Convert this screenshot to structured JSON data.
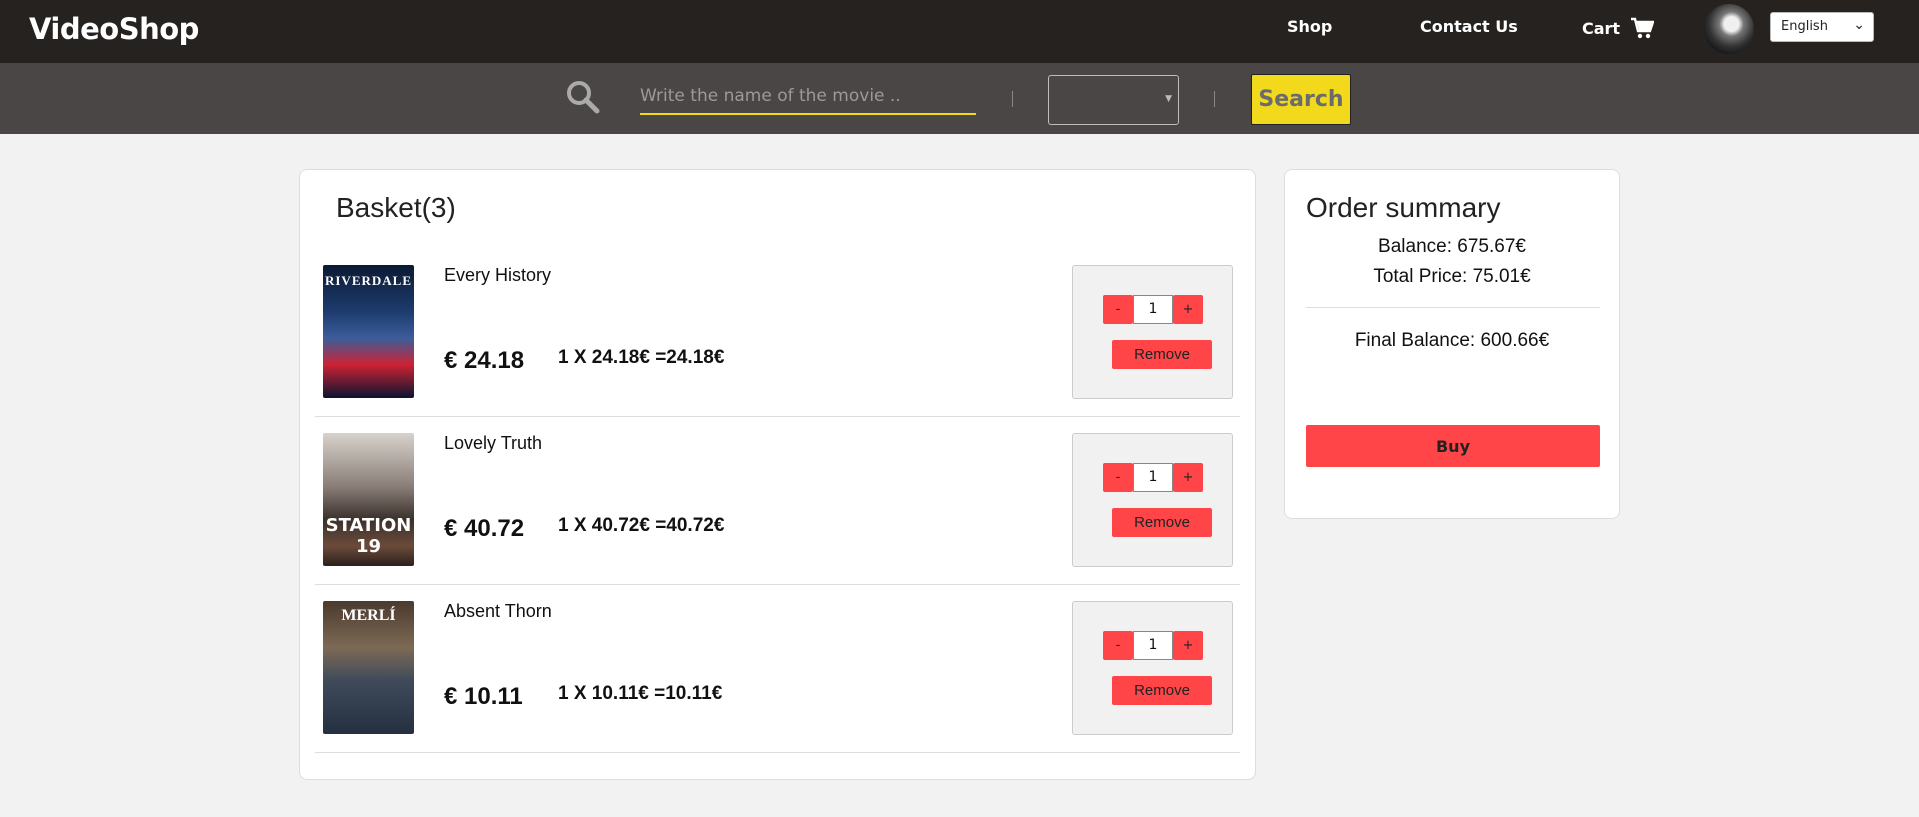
{
  "nav": {
    "brand": "VideoShop",
    "shop": "Shop",
    "contact": "Contact Us",
    "cart": "Cart",
    "language": "English"
  },
  "search": {
    "placeholder": "Write the name of the movie ..",
    "button": "Search",
    "genre_value": ""
  },
  "basket": {
    "title": "Basket(3)",
    "items": [
      {
        "name": "Every History",
        "price": "€ 24.18",
        "calc": "1 X 24.18€ =24.18€",
        "qty": "1",
        "poster_text": "RIVERDALE",
        "remove": "Remove",
        "minus": "-",
        "plus": "+"
      },
      {
        "name": "Lovely Truth",
        "price": "€ 40.72",
        "calc": "1 X 40.72€ =40.72€",
        "qty": "1",
        "poster_text": "STATION 19",
        "remove": "Remove",
        "minus": "-",
        "plus": "+"
      },
      {
        "name": "Absent Thorn",
        "price": "€ 10.11",
        "calc": "1 X 10.11€ =10.11€",
        "qty": "1",
        "poster_text": "MERLÍ",
        "remove": "Remove",
        "minus": "-",
        "plus": "+"
      }
    ]
  },
  "summary": {
    "title": "Order summary",
    "balance": "Balance: 675.67€",
    "total": "Total Price: 75.01€",
    "final": "Final Balance: 600.66€",
    "buy": "Buy"
  },
  "colors": {
    "nav_bg": "#262220",
    "search_bg": "#4a4646",
    "accent_yellow": "#f3d91b",
    "button_red": "#ff4548"
  },
  "icons": {
    "cart": "cart-icon",
    "search": "search-icon",
    "avatar": "avatar"
  }
}
